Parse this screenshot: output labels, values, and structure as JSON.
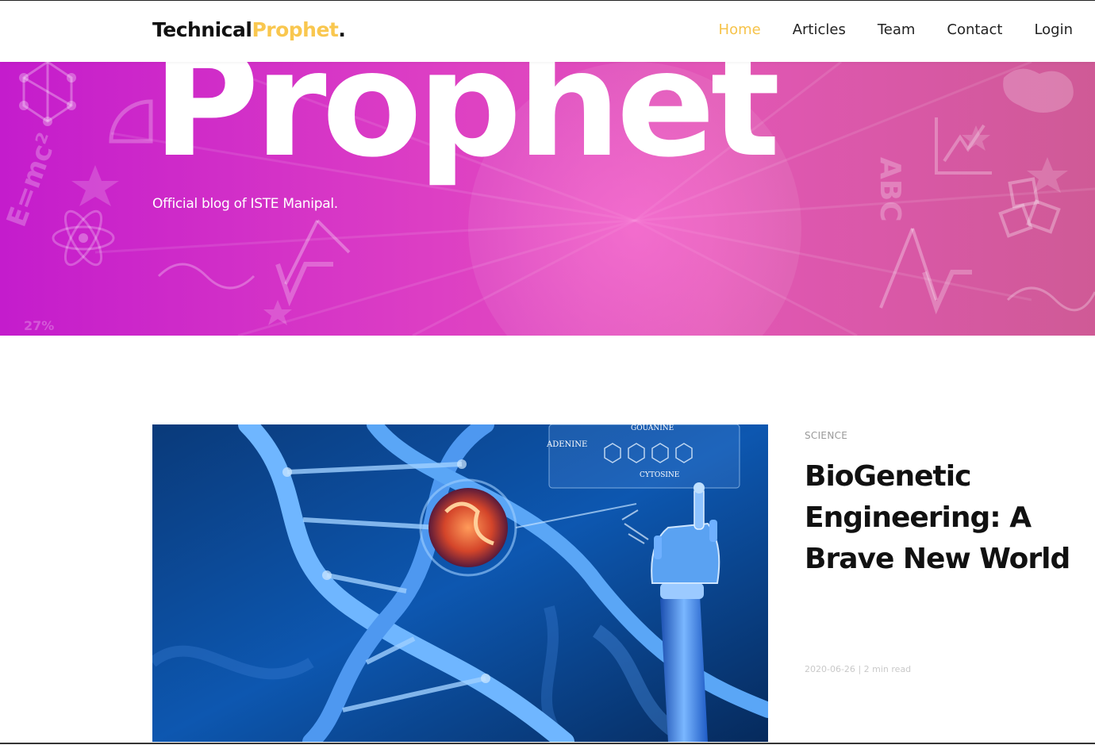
{
  "brand": {
    "part1": "Technical",
    "part2": "Prophet",
    "part3": "."
  },
  "nav": {
    "items": [
      {
        "label": "Home",
        "active": true
      },
      {
        "label": "Articles",
        "active": false
      },
      {
        "label": "Team",
        "active": false
      },
      {
        "label": "Contact",
        "active": false
      },
      {
        "label": "Login",
        "active": false
      }
    ]
  },
  "hero": {
    "title": "Prophet",
    "subtitle": "Official blog of ISTE Manipal.",
    "background_text": {
      "formula": "E=mc²",
      "abc": "ABC",
      "percent": "27%"
    }
  },
  "article": {
    "category": "SCIENCE",
    "title": "BioGenetic Engineering: A Brave New World",
    "date": "2020-06-26",
    "separator": "|",
    "read_time": "2 min read",
    "image_labels": {
      "adenine": "ADENINE",
      "guanine": "GOUANINE",
      "cytosine": "CYTOSINE"
    }
  },
  "colors": {
    "accent": "#f6c34a",
    "hero_left": "#c41ccc",
    "hero_right": "#cf5a96",
    "text_dark": "#111111"
  }
}
